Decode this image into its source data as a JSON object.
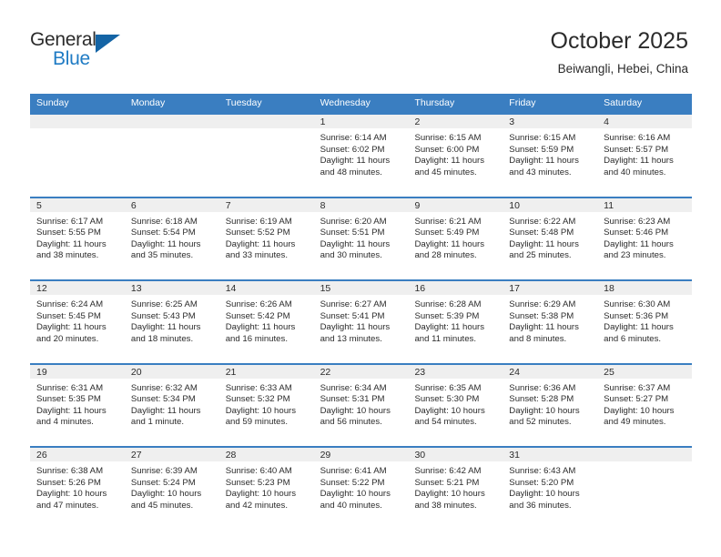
{
  "logo": {
    "word_one": "General",
    "word_two": "Blue",
    "triangle_color": "#1464a5",
    "blue_color": "#1f7bc4"
  },
  "header": {
    "title": "October 2025",
    "subtitle": "Beiwangli, Hebei, China"
  },
  "theme": {
    "header_blue": "#3a7ec1",
    "day_head_gray": "#efefef",
    "text": "#2b2b2b"
  },
  "calendar": {
    "weekday_headers": [
      "Sunday",
      "Monday",
      "Tuesday",
      "Wednesday",
      "Thursday",
      "Friday",
      "Saturday"
    ],
    "weeks": [
      [
        {
          "date": "",
          "empty": true,
          "sunrise": "",
          "sunset": "",
          "daylight": ""
        },
        {
          "date": "",
          "empty": true,
          "sunrise": "",
          "sunset": "",
          "daylight": ""
        },
        {
          "date": "",
          "empty": true,
          "sunrise": "",
          "sunset": "",
          "daylight": ""
        },
        {
          "date": "1",
          "sunrise": "Sunrise: 6:14 AM",
          "sunset": "Sunset: 6:02 PM",
          "daylight": "Daylight: 11 hours and 48 minutes."
        },
        {
          "date": "2",
          "sunrise": "Sunrise: 6:15 AM",
          "sunset": "Sunset: 6:00 PM",
          "daylight": "Daylight: 11 hours and 45 minutes."
        },
        {
          "date": "3",
          "sunrise": "Sunrise: 6:15 AM",
          "sunset": "Sunset: 5:59 PM",
          "daylight": "Daylight: 11 hours and 43 minutes."
        },
        {
          "date": "4",
          "sunrise": "Sunrise: 6:16 AM",
          "sunset": "Sunset: 5:57 PM",
          "daylight": "Daylight: 11 hours and 40 minutes."
        }
      ],
      [
        {
          "date": "5",
          "sunrise": "Sunrise: 6:17 AM",
          "sunset": "Sunset: 5:55 PM",
          "daylight": "Daylight: 11 hours and 38 minutes."
        },
        {
          "date": "6",
          "sunrise": "Sunrise: 6:18 AM",
          "sunset": "Sunset: 5:54 PM",
          "daylight": "Daylight: 11 hours and 35 minutes."
        },
        {
          "date": "7",
          "sunrise": "Sunrise: 6:19 AM",
          "sunset": "Sunset: 5:52 PM",
          "daylight": "Daylight: 11 hours and 33 minutes."
        },
        {
          "date": "8",
          "sunrise": "Sunrise: 6:20 AM",
          "sunset": "Sunset: 5:51 PM",
          "daylight": "Daylight: 11 hours and 30 minutes."
        },
        {
          "date": "9",
          "sunrise": "Sunrise: 6:21 AM",
          "sunset": "Sunset: 5:49 PM",
          "daylight": "Daylight: 11 hours and 28 minutes."
        },
        {
          "date": "10",
          "sunrise": "Sunrise: 6:22 AM",
          "sunset": "Sunset: 5:48 PM",
          "daylight": "Daylight: 11 hours and 25 minutes."
        },
        {
          "date": "11",
          "sunrise": "Sunrise: 6:23 AM",
          "sunset": "Sunset: 5:46 PM",
          "daylight": "Daylight: 11 hours and 23 minutes."
        }
      ],
      [
        {
          "date": "12",
          "sunrise": "Sunrise: 6:24 AM",
          "sunset": "Sunset: 5:45 PM",
          "daylight": "Daylight: 11 hours and 20 minutes."
        },
        {
          "date": "13",
          "sunrise": "Sunrise: 6:25 AM",
          "sunset": "Sunset: 5:43 PM",
          "daylight": "Daylight: 11 hours and 18 minutes."
        },
        {
          "date": "14",
          "sunrise": "Sunrise: 6:26 AM",
          "sunset": "Sunset: 5:42 PM",
          "daylight": "Daylight: 11 hours and 16 minutes."
        },
        {
          "date": "15",
          "sunrise": "Sunrise: 6:27 AM",
          "sunset": "Sunset: 5:41 PM",
          "daylight": "Daylight: 11 hours and 13 minutes."
        },
        {
          "date": "16",
          "sunrise": "Sunrise: 6:28 AM",
          "sunset": "Sunset: 5:39 PM",
          "daylight": "Daylight: 11 hours and 11 minutes."
        },
        {
          "date": "17",
          "sunrise": "Sunrise: 6:29 AM",
          "sunset": "Sunset: 5:38 PM",
          "daylight": "Daylight: 11 hours and 8 minutes."
        },
        {
          "date": "18",
          "sunrise": "Sunrise: 6:30 AM",
          "sunset": "Sunset: 5:36 PM",
          "daylight": "Daylight: 11 hours and 6 minutes."
        }
      ],
      [
        {
          "date": "19",
          "sunrise": "Sunrise: 6:31 AM",
          "sunset": "Sunset: 5:35 PM",
          "daylight": "Daylight: 11 hours and 4 minutes."
        },
        {
          "date": "20",
          "sunrise": "Sunrise: 6:32 AM",
          "sunset": "Sunset: 5:34 PM",
          "daylight": "Daylight: 11 hours and 1 minute."
        },
        {
          "date": "21",
          "sunrise": "Sunrise: 6:33 AM",
          "sunset": "Sunset: 5:32 PM",
          "daylight": "Daylight: 10 hours and 59 minutes."
        },
        {
          "date": "22",
          "sunrise": "Sunrise: 6:34 AM",
          "sunset": "Sunset: 5:31 PM",
          "daylight": "Daylight: 10 hours and 56 minutes."
        },
        {
          "date": "23",
          "sunrise": "Sunrise: 6:35 AM",
          "sunset": "Sunset: 5:30 PM",
          "daylight": "Daylight: 10 hours and 54 minutes."
        },
        {
          "date": "24",
          "sunrise": "Sunrise: 6:36 AM",
          "sunset": "Sunset: 5:28 PM",
          "daylight": "Daylight: 10 hours and 52 minutes."
        },
        {
          "date": "25",
          "sunrise": "Sunrise: 6:37 AM",
          "sunset": "Sunset: 5:27 PM",
          "daylight": "Daylight: 10 hours and 49 minutes."
        }
      ],
      [
        {
          "date": "26",
          "sunrise": "Sunrise: 6:38 AM",
          "sunset": "Sunset: 5:26 PM",
          "daylight": "Daylight: 10 hours and 47 minutes."
        },
        {
          "date": "27",
          "sunrise": "Sunrise: 6:39 AM",
          "sunset": "Sunset: 5:24 PM",
          "daylight": "Daylight: 10 hours and 45 minutes."
        },
        {
          "date": "28",
          "sunrise": "Sunrise: 6:40 AM",
          "sunset": "Sunset: 5:23 PM",
          "daylight": "Daylight: 10 hours and 42 minutes."
        },
        {
          "date": "29",
          "sunrise": "Sunrise: 6:41 AM",
          "sunset": "Sunset: 5:22 PM",
          "daylight": "Daylight: 10 hours and 40 minutes."
        },
        {
          "date": "30",
          "sunrise": "Sunrise: 6:42 AM",
          "sunset": "Sunset: 5:21 PM",
          "daylight": "Daylight: 10 hours and 38 minutes."
        },
        {
          "date": "31",
          "sunrise": "Sunrise: 6:43 AM",
          "sunset": "Sunset: 5:20 PM",
          "daylight": "Daylight: 10 hours and 36 minutes."
        },
        {
          "date": "",
          "empty": true,
          "sunrise": "",
          "sunset": "",
          "daylight": ""
        }
      ]
    ]
  }
}
